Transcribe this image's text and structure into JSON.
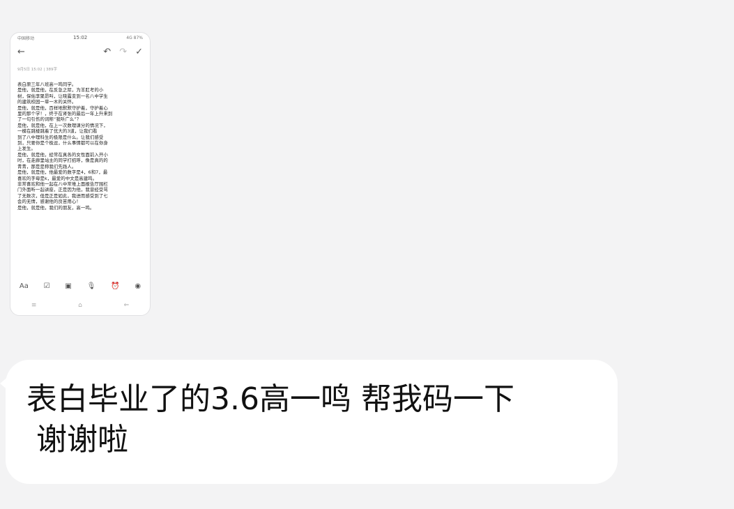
{
  "thumbnail": {
    "status_bar": {
      "left": "中国移动",
      "time": "15:02",
      "right": "4G 87%"
    },
    "toolbar_icons": [
      "back-arrow-icon",
      "undo-icon",
      "redo-icon",
      "check-icon"
    ],
    "meta": "9月5日 15:02 | 389字",
    "note_lines": [
      "表白原三年八班高一鸣同学。",
      "是他，就是他，在反急之际，为羊肛考的小",
      "树，保佑李聚昂叫，让晓露变到一名八中学生",
      "的建筑校园一草一木的关怀。",
      "是他，就是他，百样地默默守护着，守护着心",
      "里的那个学！，终于在肾张的最后一年上升来到",
      "了一句引伤的词称“我听广么”？",
      "是他，就是他，在上一次数理课分的情况下，",
      "一模在跳楼跳着了优大的3道，让我们看",
      "到了八中理科生的极限是什么。让我们感受",
      "到，只要你是个极逗，什么事情都可以在你身",
      "上发生。",
      "是他，就是他，经常在真各的女性面前入开小",
      "时，在走廊里站主的同学打招呼，像是真的的",
      "青青，那是是称我们先践人。",
      "是他，就是他，他最爱的数字是4，6和7，最",
      "喜欢的字母是k，最爱的中文是高建鸣。",
      "非常喜欢和他一起在八中常堆上面报告厅围栏",
      "门外面听一起讲座，正是因为他，我曾经受骂",
      "了无数次，但是正是如此，我进而感受到了七",
      "会的无情，感谢他的良苦用心！",
      "是他，就是他，我们的朋友，高一鸣。"
    ],
    "editor_tools": [
      "Aa",
      "☑",
      "▣",
      "🎙",
      "⏰",
      "◉"
    ],
    "nav_icons": [
      "≡",
      "⌂",
      "⇐"
    ]
  },
  "message": {
    "line1": "表白毕业了的3.6高一鸣 帮我码一下",
    "line2": "谢谢啦"
  }
}
